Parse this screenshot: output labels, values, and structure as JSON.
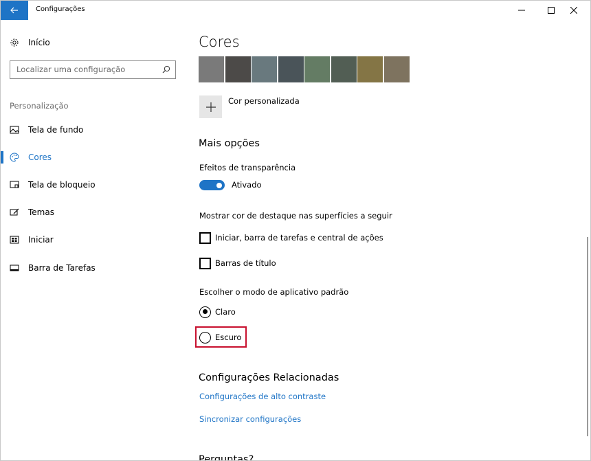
{
  "titlebar": {
    "title": "Configurações"
  },
  "sidebar": {
    "home_label": "Início",
    "search_placeholder": "Localizar uma configuração",
    "section_label": "Personalização",
    "items": [
      {
        "label": "Tela de fundo",
        "icon": "image-icon",
        "active": false
      },
      {
        "label": "Cores",
        "icon": "palette-icon",
        "active": true
      },
      {
        "label": "Tela de bloqueio",
        "icon": "lock-screen-icon",
        "active": false
      },
      {
        "label": "Temas",
        "icon": "themes-icon",
        "active": false
      },
      {
        "label": "Iniciar",
        "icon": "start-icon",
        "active": false
      },
      {
        "label": "Barra de Tarefas",
        "icon": "taskbar-icon",
        "active": false
      }
    ]
  },
  "main": {
    "heading": "Cores",
    "swatches": [
      "#7a7a7a",
      "#4c4a48",
      "#69797e",
      "#4a5459",
      "#647c64",
      "#525e54",
      "#847545",
      "#7e735f"
    ],
    "custom_color_label": "Cor personalizada",
    "more_options_heading": "Mais opções",
    "transparency_label": "Efeitos de transparência",
    "transparency_state": "Ativado",
    "accent_surfaces_label": "Mostrar cor de destaque nas superfícies a seguir",
    "checkbox_start": "Iniciar, barra de tarefas e central de ações",
    "checkbox_title": "Barras de título",
    "app_mode_label": "Escolher o modo de aplicativo padrão",
    "radio_light": "Claro",
    "radio_dark": "Escuro",
    "related_heading": "Configurações Relacionadas",
    "link_contrast": "Configurações de alto contraste",
    "link_sync": "Sincronizar configurações",
    "questions_heading": "Perguntas?"
  },
  "colors": {
    "accent": "#1e74c6",
    "highlight": "#c8102e"
  }
}
